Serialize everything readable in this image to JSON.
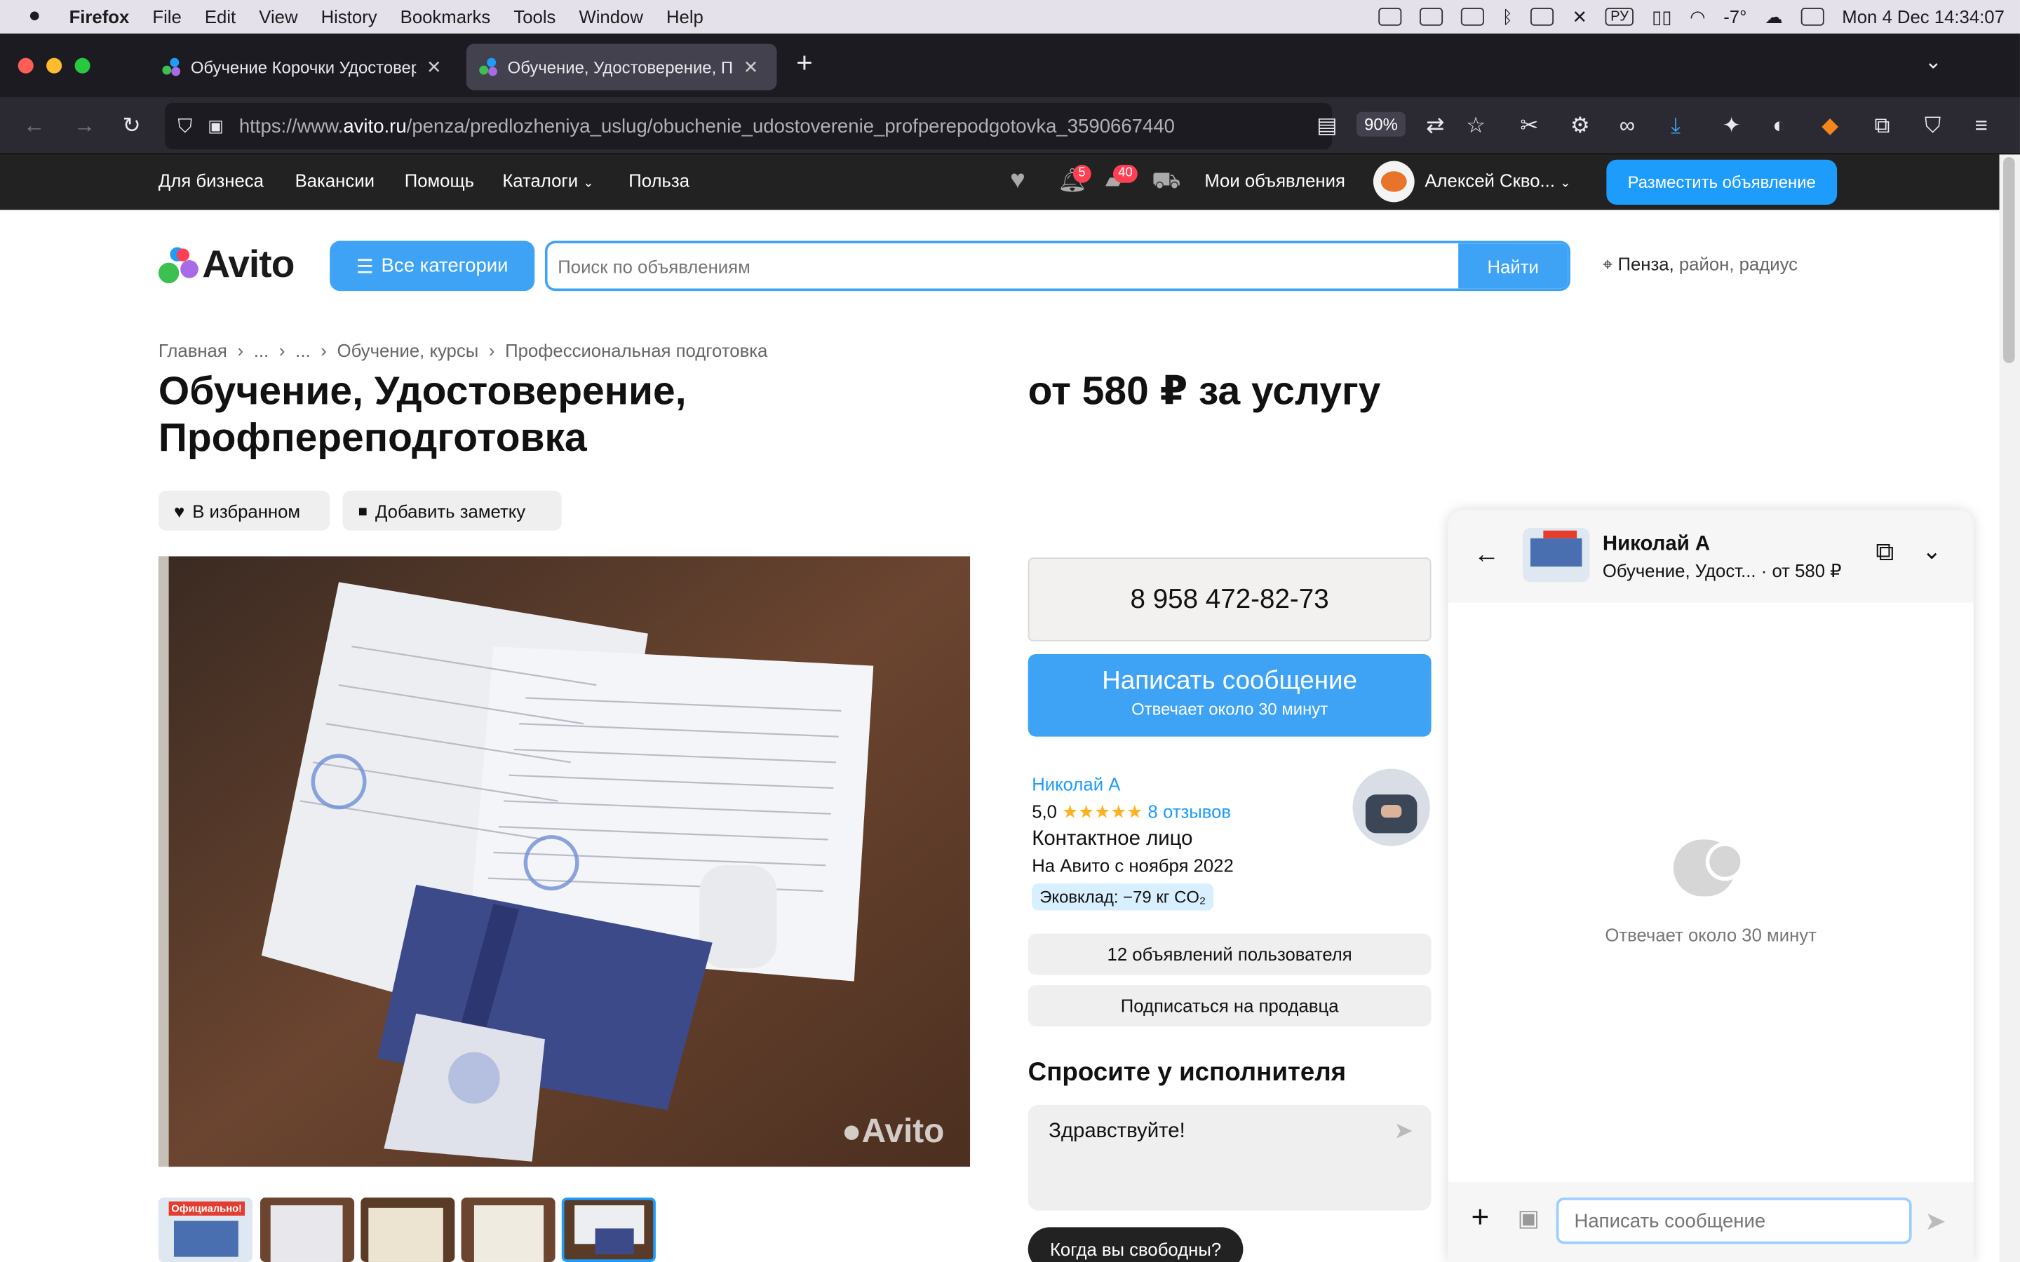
{
  "menubar": {
    "app": "Firefox",
    "items": [
      "File",
      "Edit",
      "View",
      "History",
      "Bookmarks",
      "Tools",
      "Window",
      "Help"
    ],
    "lang": "РУ",
    "weather": "-7°",
    "datetime": "Mon 4 Dec  14:34:07"
  },
  "tabs": [
    {
      "title": "Обучение Корочки Удостовере"
    },
    {
      "title": "Обучение, Удостоверение, Пр"
    }
  ],
  "urlbar": {
    "prefix": "https://www.",
    "host": "avito.ru",
    "path": "/penza/predlozheniya_uslug/obuchenie_udostoverenie_profperepodgotovka_3590667440",
    "zoom": "90%"
  },
  "sitebar": {
    "links": [
      "Для бизнеса",
      "Вакансии",
      "Помощь",
      "Каталоги",
      "Польза"
    ],
    "notif_count": "5",
    "messages_count": "40",
    "my_ads": "Мои объявления",
    "user": "Алексей Скво...",
    "post_ad": "Разместить объявление"
  },
  "header": {
    "logo": "Avito",
    "categories": "Все категории",
    "search_placeholder": "Поиск по объявлениям",
    "search_button": "Найти",
    "location": "Пенза,",
    "location_hint": " район, радиус"
  },
  "breadcrumbs": [
    "Главная",
    "›",
    "...",
    "›",
    "...",
    "›",
    "Обучение, курсы",
    "›",
    "Профессиональная подготовка"
  ],
  "listing": {
    "title": "Обучение, Удостоверение, Профпереподготовка",
    "price": "от 580 ₽ за услугу",
    "favorite": "В избранном",
    "note": "Добавить заметку",
    "watermark": "Avito",
    "thumb_label": "Официально!"
  },
  "contact": {
    "phone": "8 958 472-82-73",
    "write": "Написать сообщение",
    "reply_time": "Отвечает около 30 минут"
  },
  "seller": {
    "name": "Николай А",
    "rating": "5,0",
    "stars": "★★★★★",
    "reviews": "8 отзывов",
    "type": "Контактное лицо",
    "since": "На Авито с ноября 2022",
    "eco": "Эковклад: −79 кг CO₂",
    "ads_count": "12 объявлений пользователя",
    "subscribe": "Подписаться на продавца"
  },
  "ask": {
    "heading": "Спросите у исполнителя",
    "message": "Здравствуйте!",
    "quick_reply": "Когда вы свободны?"
  },
  "chat": {
    "name": "Николай А",
    "subtitle": "Обучение, Удост...",
    "price": "· от 580 ₽",
    "reply_time": "Отвечает около 30 минут",
    "input_placeholder": "Написать сообщение"
  }
}
